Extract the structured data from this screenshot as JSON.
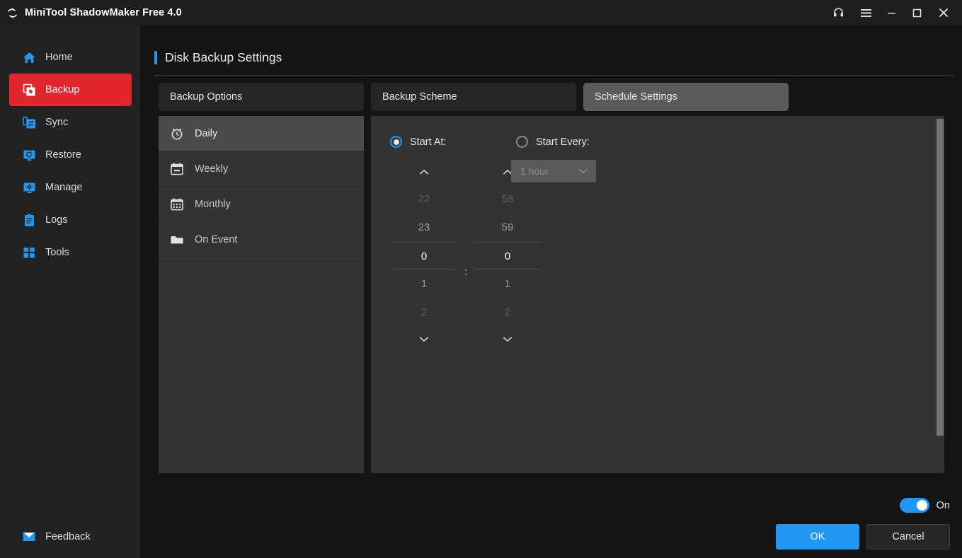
{
  "window": {
    "title": "MiniTool ShadowMaker Free 4.0",
    "logo_icon": "sync-arrows-icon",
    "controls": [
      {
        "name": "support-headset-button",
        "icon": "headset-icon"
      },
      {
        "name": "menu-button",
        "icon": "hamburger-menu-icon"
      },
      {
        "name": "minimize-button",
        "icon": "minimize-icon"
      },
      {
        "name": "maximize-button",
        "icon": "maximize-icon"
      },
      {
        "name": "close-button",
        "icon": "close-icon"
      }
    ]
  },
  "sidebar": {
    "items": [
      {
        "label": "Home",
        "icon": "home-icon",
        "active": false
      },
      {
        "label": "Backup",
        "icon": "backup-icon",
        "active": true
      },
      {
        "label": "Sync",
        "icon": "sync-icon",
        "active": false
      },
      {
        "label": "Restore",
        "icon": "restore-icon",
        "active": false
      },
      {
        "label": "Manage",
        "icon": "manage-gear-monitor-icon",
        "active": false
      },
      {
        "label": "Logs",
        "icon": "logs-clipboard-icon",
        "active": false
      },
      {
        "label": "Tools",
        "icon": "tools-grid-icon",
        "active": false
      }
    ],
    "feedback": {
      "label": "Feedback",
      "icon": "envelope-icon"
    }
  },
  "main": {
    "page_title": "Disk Backup Settings",
    "tabs": [
      {
        "label": "Backup Options",
        "active": false
      },
      {
        "label": "Backup Scheme",
        "active": false
      },
      {
        "label": "Schedule Settings",
        "active": true
      }
    ],
    "schedule_list": [
      {
        "label": "Daily",
        "icon": "alarm-clock-icon",
        "active": true
      },
      {
        "label": "Weekly",
        "icon": "calendar-icon",
        "active": false
      },
      {
        "label": "Monthly",
        "icon": "calendar-grid-icon",
        "active": false
      },
      {
        "label": "On Event",
        "icon": "folder-icon",
        "active": false
      }
    ],
    "daily": {
      "start_at": {
        "label": "Start At:",
        "selected": true
      },
      "start_every": {
        "label": "Start Every:",
        "selected": false
      },
      "interval_select": {
        "value": "1 hour",
        "disabled": true,
        "chevron_icon": "chevron-down-icon"
      },
      "time_separator": ":",
      "hours": {
        "up_icon": "chevron-up-icon",
        "down_icon": "chevron-down-icon",
        "values": [
          "22",
          "23",
          "0",
          "1",
          "2"
        ],
        "selected_index": 2
      },
      "minutes": {
        "up_icon": "chevron-up-icon",
        "down_icon": "chevron-down-icon",
        "values": [
          "58",
          "59",
          "0",
          "1",
          "2"
        ],
        "selected_index": 2
      }
    }
  },
  "footer": {
    "toggle": {
      "label": "On",
      "on": true
    },
    "ok_label": "OK",
    "cancel_label": "Cancel"
  },
  "colors": {
    "accent_blue": "#2196f3",
    "brand_red": "#e1262d",
    "window_bg": "#141414",
    "sidebar_bg": "#222222",
    "panel_bg": "#333333"
  }
}
